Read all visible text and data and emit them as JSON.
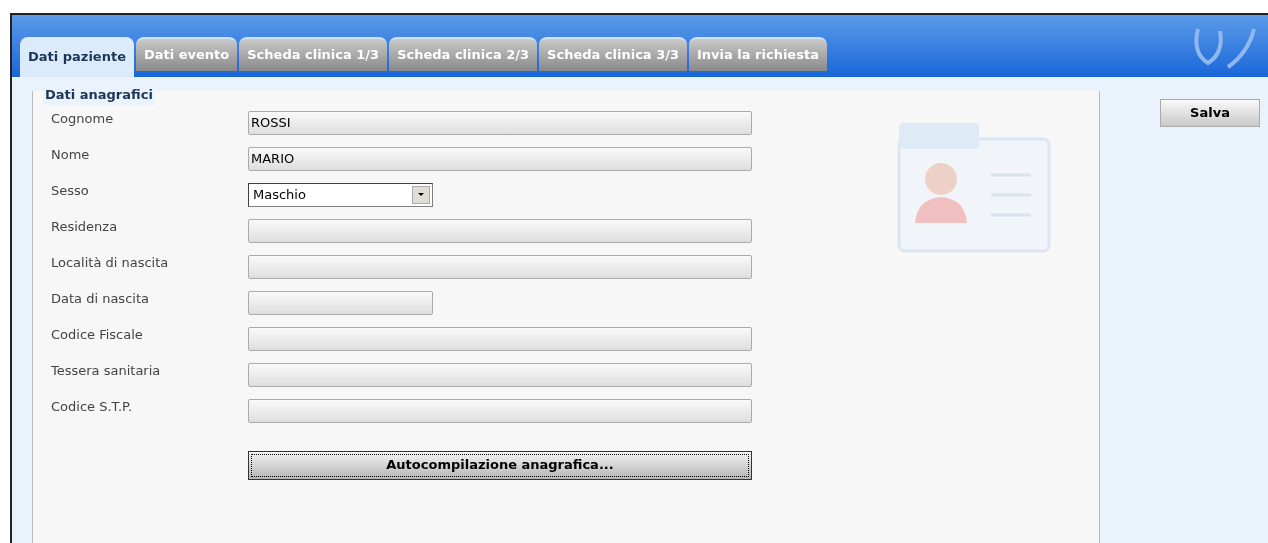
{
  "tabs": [
    {
      "label": "Dati paziente",
      "selected": true
    },
    {
      "label": "Dati evento",
      "selected": false
    },
    {
      "label": "Scheda clinica 1/3",
      "selected": false
    },
    {
      "label": "Scheda clinica 2/3",
      "selected": false
    },
    {
      "label": "Scheda clinica 3/3",
      "selected": false
    },
    {
      "label": "Invia la richiesta",
      "selected": false
    }
  ],
  "section": {
    "title": "Dati anagrafici",
    "fields": [
      {
        "label": "Cognome",
        "kind": "text",
        "value": "ROSSI"
      },
      {
        "label": "Nome",
        "kind": "text",
        "value": "MARIO"
      },
      {
        "label": "Sesso",
        "kind": "select",
        "value": "Maschio"
      },
      {
        "label": "Residenza",
        "kind": "text"
      },
      {
        "label": "Località di nascita",
        "kind": "text"
      },
      {
        "label": "Data di nascita",
        "kind": "date"
      },
      {
        "label": "Codice Fiscale",
        "kind": "text"
      },
      {
        "label": "Tessera sanitaria",
        "kind": "text"
      },
      {
        "label": "Codice S.T.P.",
        "kind": "text"
      }
    ],
    "autofill_button": "Autocompilazione anagrafica..."
  },
  "save_button": "Salva"
}
